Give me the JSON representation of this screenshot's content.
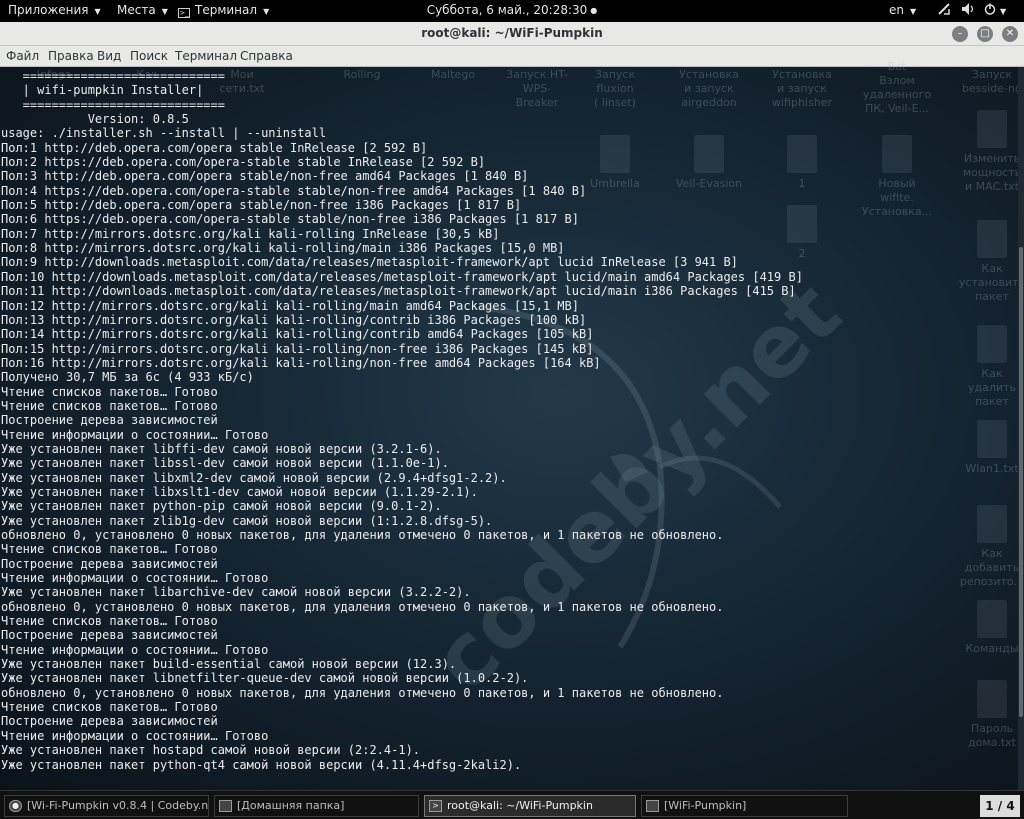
{
  "topbar": {
    "applications": "Приложения",
    "places": "Места",
    "terminal": "Терминал",
    "clock": "Суббота,  6 май., 20:28:30",
    "language": "en"
  },
  "window": {
    "title": "root@kali: ~/WiFi-Pumpkin"
  },
  "menu": [
    "Файл",
    "Правка",
    "Вид",
    "Поиск",
    "Терминал",
    "Справка"
  ],
  "desktop_icons": [
    {
      "label": "Infoga"
    },
    {
      "label": "Как"
    },
    {
      "label": "Мои\nсети.txt"
    },
    {
      "label": "Rolling"
    },
    {
      "label": "Maltego"
    },
    {
      "label": "Запуск HT-\nWPS-\nBreaker"
    },
    {
      "label": "Запуск\nfluxion\n( linset)"
    },
    {
      "label": "Установка\nи запуск\nairgeddon"
    },
    {
      "label": "Установка\nи запуск\nwifiphisher"
    },
    {
      "label": "Bot\nВзлом\nудаленного\nПК, Veil-E..."
    },
    {
      "label": "Запуск\nbesside-ng"
    },
    {
      "label": "Umbrella"
    },
    {
      "label": "Veil-Evasion"
    },
    {
      "label": "1"
    },
    {
      "label": "Новый\nwifite.\nУстановка..."
    },
    {
      "label": "Изменить\nмощность\nи МАС.txt"
    },
    {
      "label": "2"
    },
    {
      "label": "Как\nустановить\nпакет"
    },
    {
      "label": "Как\nудалить\nпакет"
    },
    {
      "label": "Wlan1.txt"
    },
    {
      "label": "Как\nдобавить\nрепозито..."
    },
    {
      "label": "Команды"
    },
    {
      "label": "Пароль\nдома.txt"
    }
  ],
  "watermark": "codeby.net",
  "terminal_lines": [
    "   ============================",
    "   | wifi-pumpkin Installer|",
    "   ============================",
    "            Version: 0.8.5",
    "usage: ./installer.sh --install | --uninstall",
    "Пол:1 http://deb.opera.com/opera stable InRelease [2 592 B]",
    "Пол:2 https://deb.opera.com/opera-stable stable InRelease [2 592 B]",
    "Пол:3 http://deb.opera.com/opera stable/non-free amd64 Packages [1 840 B]",
    "Пол:4 https://deb.opera.com/opera-stable stable/non-free amd64 Packages [1 840 B]",
    "Пол:5 http://deb.opera.com/opera stable/non-free i386 Packages [1 817 B]",
    "Пол:6 https://deb.opera.com/opera-stable stable/non-free i386 Packages [1 817 B]",
    "Пол:7 http://mirrors.dotsrc.org/kali kali-rolling InRelease [30,5 kB]",
    "Пол:8 http://mirrors.dotsrc.org/kali kali-rolling/main i386 Packages [15,0 MB]",
    "Пол:9 http://downloads.metasploit.com/data/releases/metasploit-framework/apt lucid InRelease [3 941 B]",
    "Пол:10 http://downloads.metasploit.com/data/releases/metasploit-framework/apt lucid/main amd64 Packages [419 B]",
    "Пол:11 http://downloads.metasploit.com/data/releases/metasploit-framework/apt lucid/main i386 Packages [415 B]",
    "Пол:12 http://mirrors.dotsrc.org/kali kali-rolling/main amd64 Packages [15,1 MB]",
    "Пол:13 http://mirrors.dotsrc.org/kali kali-rolling/contrib i386 Packages [100 kB]",
    "Пол:14 http://mirrors.dotsrc.org/kali kali-rolling/contrib amd64 Packages [105 kB]",
    "Пол:15 http://mirrors.dotsrc.org/kali kali-rolling/non-free i386 Packages [145 kB]",
    "Пол:16 http://mirrors.dotsrc.org/kali kali-rolling/non-free amd64 Packages [164 kB]",
    "Получено 30,7 МБ за 6с (4 933 кБ/c)",
    "Чтение списков пакетов… Готово",
    "Чтение списков пакетов… Готово",
    "Построение дерева зависимостей",
    "Чтение информации о состоянии… Готово",
    "Уже установлен пакет libffi-dev самой новой версии (3.2.1-6).",
    "Уже установлен пакет libssl-dev самой новой версии (1.1.0e-1).",
    "Уже установлен пакет libxml2-dev самой новой версии (2.9.4+dfsg1-2.2).",
    "Уже установлен пакет libxslt1-dev самой новой версии (1.1.29-2.1).",
    "Уже установлен пакет python-pip самой новой версии (9.0.1-2).",
    "Уже установлен пакет zlib1g-dev самой новой версии (1:1.2.8.dfsg-5).",
    "обновлено 0, установлено 0 новых пакетов, для удаления отмечено 0 пакетов, и 1 пакетов не обновлено.",
    "Чтение списков пакетов… Готово",
    "Построение дерева зависимостей",
    "Чтение информации о состоянии… Готово",
    "Уже установлен пакет libarchive-dev самой новой версии (3.2.2-2).",
    "обновлено 0, установлено 0 новых пакетов, для удаления отмечено 0 пакетов, и 1 пакетов не обновлено.",
    "Чтение списков пакетов… Готово",
    "Построение дерева зависимостей",
    "Чтение информации о состоянии… Готово",
    "Уже установлен пакет build-essential самой новой версии (12.3).",
    "Уже установлен пакет libnetfilter-queue-dev самой новой версии (1.0.2-2).",
    "обновлено 0, установлено 0 новых пакетов, для удаления отмечено 0 пакетов, и 1 пакетов не обновлено.",
    "Чтение списков пакетов… Готово",
    "Построение дерева зависимостей",
    "Чтение информации о состоянии… Готово",
    "Уже установлен пакет hostapd самой новой версии (2:2.4-1).",
    "Уже установлен пакет python-qt4 самой новой версии (4.11.4+dfsg-2kali2)."
  ],
  "taskbar": {
    "tasks": [
      "[Wi-Fi-Pumpkin v0.8.4 | Codeby.n...",
      "[Домашняя папка]",
      "root@kali: ~/WiFi-Pumpkin",
      "[WiFi-Pumpkin]"
    ],
    "pager": "1 / 4"
  }
}
